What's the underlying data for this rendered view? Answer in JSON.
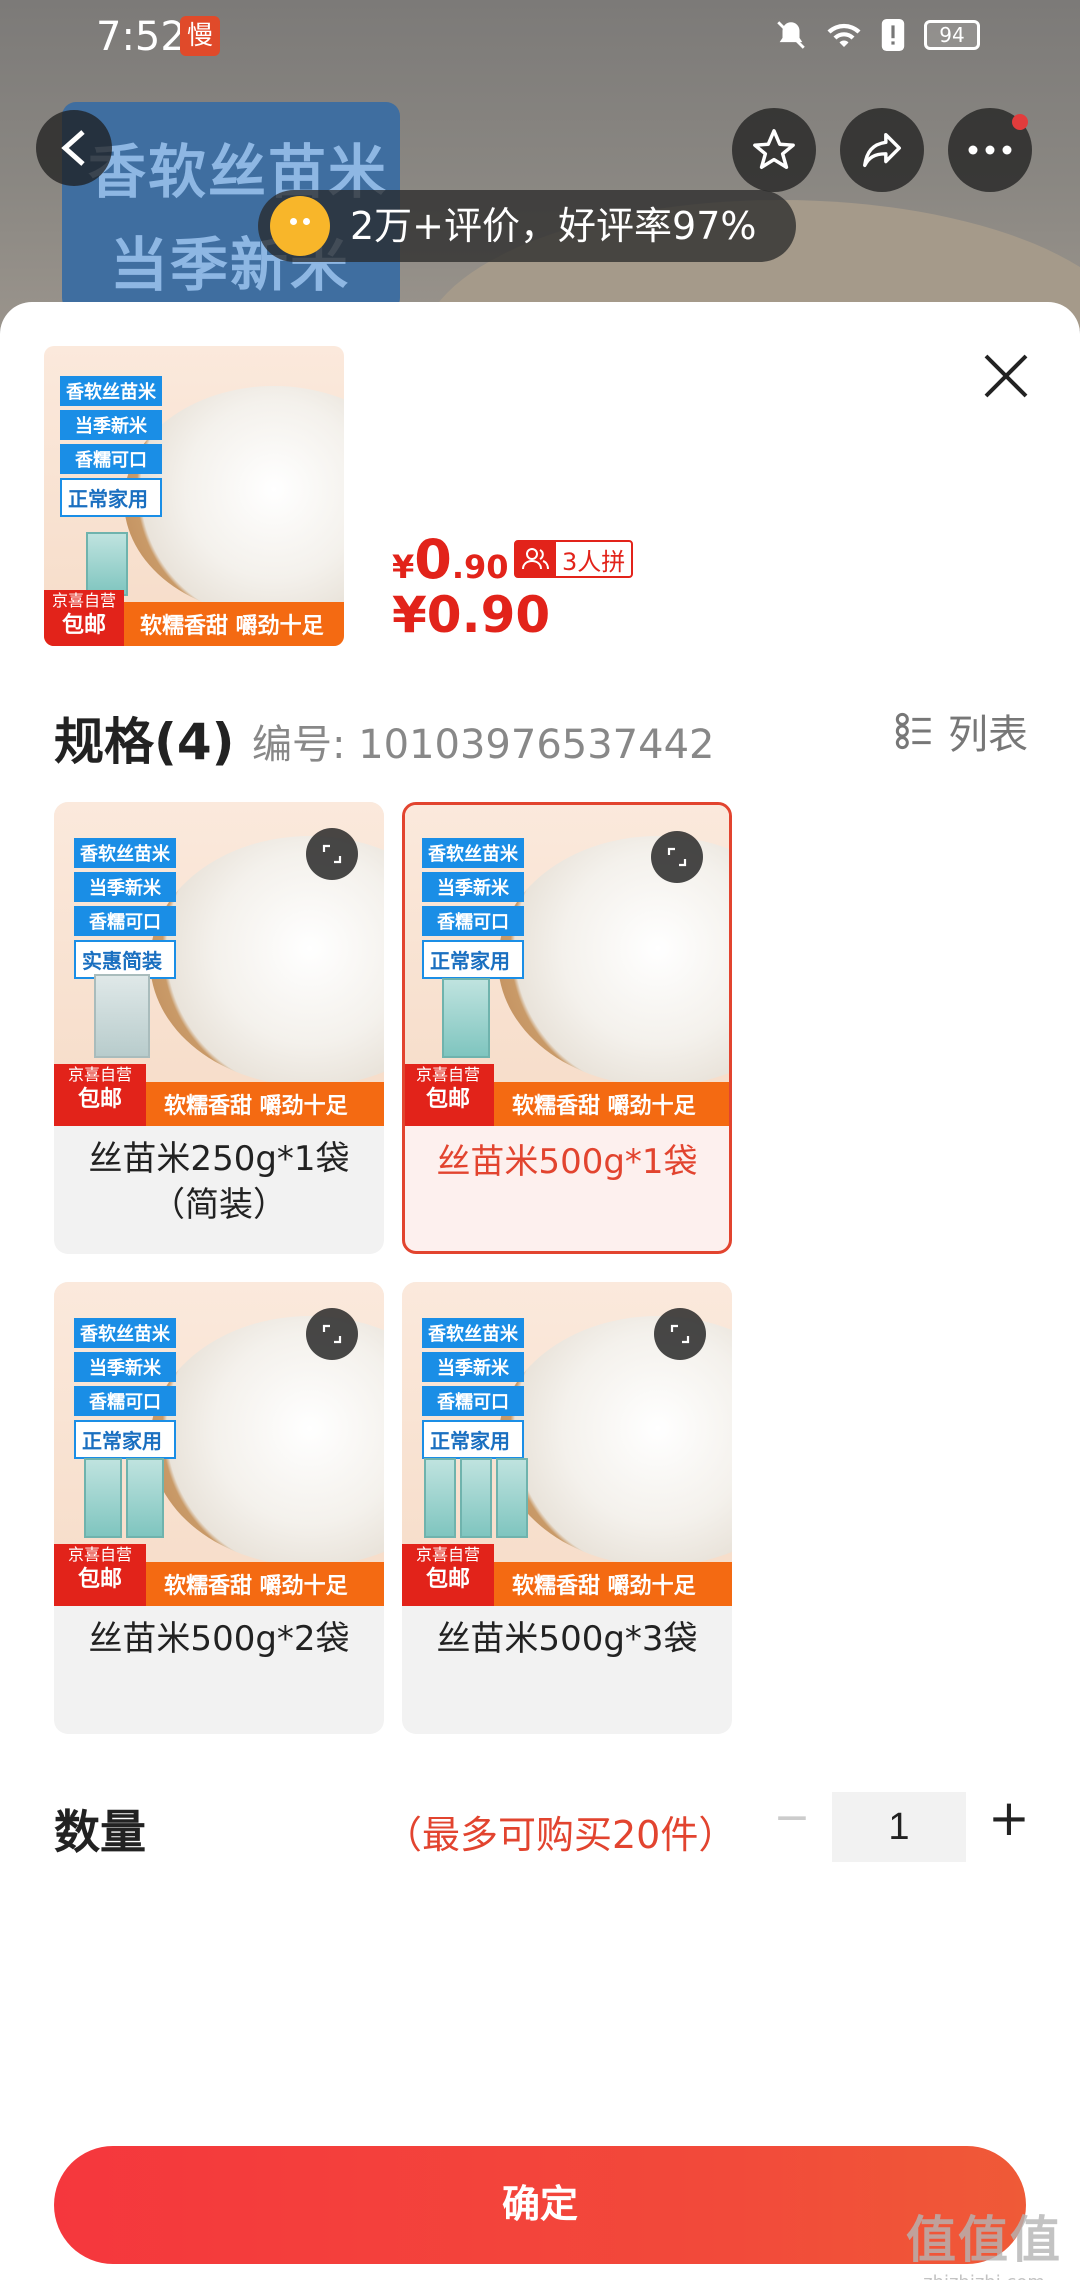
{
  "status_bar": {
    "time": "7:52",
    "app_badge": "慢",
    "battery": "94"
  },
  "background": {
    "banner_line1": "香软丝苗米",
    "banner_line2": "当季新米",
    "review_summary": "2万+评价，好评率97%"
  },
  "sheet": {
    "product": {
      "image_tags": [
        "香软丝苗米",
        "当季新米",
        "香糯可口"
      ],
      "image_tag_variant": "正常家用",
      "jd_self": "京喜自营",
      "jd_post": "包邮",
      "slogan": "软糯香甜 嚼劲十足",
      "price_yen": "¥",
      "price_int": "0",
      "price_dec": ".90",
      "group_label": "3人拼",
      "price_full": "¥0.90"
    },
    "spec": {
      "title": "规格(4)",
      "code": "编号: 10103976537442",
      "list_toggle_label": "列表",
      "options": [
        {
          "label": "丝苗米250g*1袋（简装）",
          "variant_tag": "实惠简装",
          "selected": false
        },
        {
          "label": "丝苗米500g*1袋",
          "variant_tag": "正常家用",
          "selected": true
        },
        {
          "label": "丝苗米500g*2袋",
          "variant_tag": "正常家用",
          "selected": false
        },
        {
          "label": "丝苗米500g*3袋",
          "variant_tag": "正常家用",
          "selected": false
        }
      ]
    },
    "quantity": {
      "title": "数量",
      "limit": "（最多可购买20件）",
      "minus": "−",
      "value": "1",
      "plus": "+"
    },
    "confirm_label": "确定"
  },
  "watermark": {
    "main": "值值值",
    "sub": "zhizhizhi.com"
  },
  "colors": {
    "accent_red": "#e2231a",
    "selected_border": "#e2442f",
    "tag_blue": "#1a8ee6",
    "slogan_orange": "#f46a12"
  }
}
